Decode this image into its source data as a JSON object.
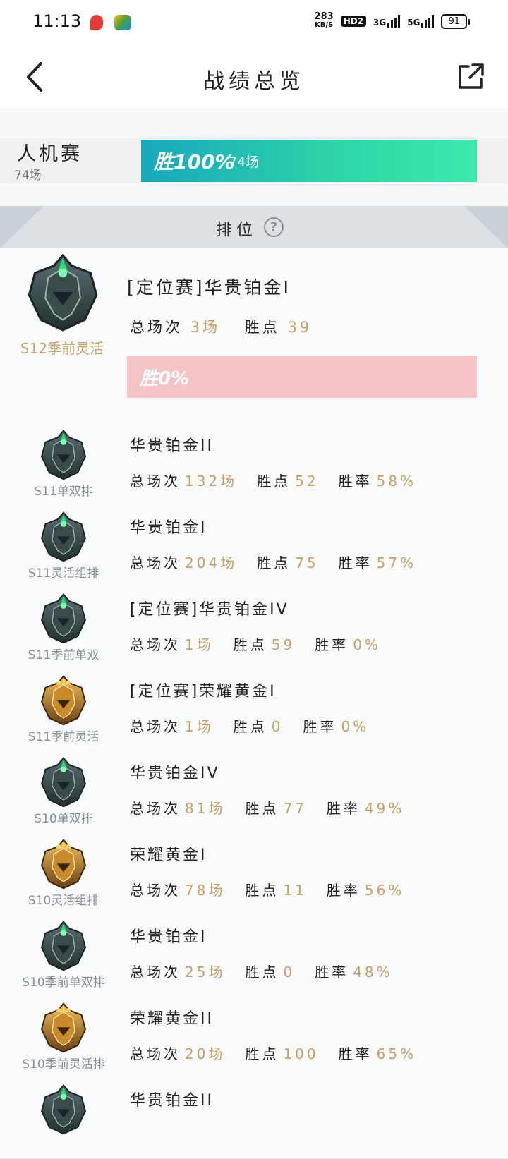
{
  "status_bar": {
    "time": "11:13",
    "speed_value": "283",
    "speed_unit": "KB/S",
    "hd": "HD2",
    "net1": "3G",
    "net2": "5G",
    "battery": "91"
  },
  "nav": {
    "title": "战绩总览"
  },
  "pve": {
    "label": "人机赛",
    "count": "74场",
    "win_rate_text": "胜100%",
    "win_count": "74场",
    "win_fraction": 1.0
  },
  "ranked_header": {
    "label": "排位",
    "help": "?"
  },
  "featured": {
    "season": "S12季前灵活",
    "rank": "[定位赛]华贵铂金I",
    "total_label": "总场次",
    "total": "3场",
    "points_label": "胜点",
    "points": "39",
    "loss_bar_text": "胜0%",
    "emblem": "platinum-emblem"
  },
  "labels": {
    "total": "总场次",
    "points": "胜点",
    "rate": "胜率"
  },
  "rows": [
    {
      "season": "S11单双排",
      "rank": "华贵铂金II",
      "total": "132场",
      "points": "52",
      "rate": "58%",
      "emblem": "platinum"
    },
    {
      "season": "S11灵活组排",
      "rank": "华贵铂金I",
      "total": "204场",
      "points": "75",
      "rate": "57%",
      "emblem": "platinum"
    },
    {
      "season": "S11季前单双",
      "rank": "[定位赛]华贵铂金IV",
      "total": "1场",
      "points": "59",
      "rate": "0%",
      "emblem": "platinum"
    },
    {
      "season": "S11季前灵活",
      "rank": "[定位赛]荣耀黄金I",
      "total": "1场",
      "points": "0",
      "rate": "0%",
      "emblem": "gold"
    },
    {
      "season": "S10单双排",
      "rank": "华贵铂金IV",
      "total": "81场",
      "points": "77",
      "rate": "49%",
      "emblem": "platinum"
    },
    {
      "season": "S10灵活组排",
      "rank": "荣耀黄金I",
      "total": "78场",
      "points": "11",
      "rate": "56%",
      "emblem": "gold"
    },
    {
      "season": "S10季前单双排",
      "rank": "华贵铂金I",
      "total": "25场",
      "points": "0",
      "rate": "48%",
      "emblem": "platinum"
    },
    {
      "season": "S10季前灵活排",
      "rank": "荣耀黄金II",
      "total": "20场",
      "points": "100",
      "rate": "65%",
      "emblem": "gold"
    },
    {
      "season": "",
      "rank": "华贵铂金II",
      "total": "",
      "points": "",
      "rate": "",
      "emblem": "platinum"
    }
  ]
}
